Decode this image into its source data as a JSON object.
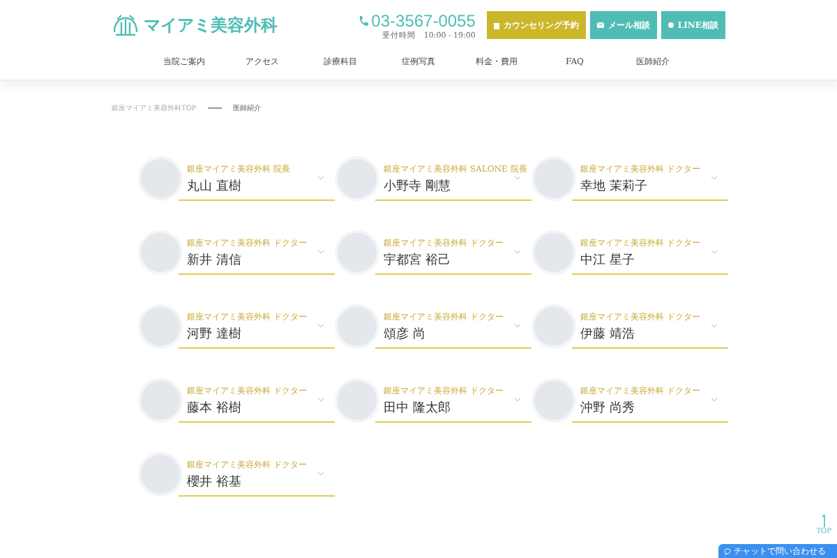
{
  "header": {
    "logo_text": "マイアミ美容外科",
    "phone": "03-3567-0055",
    "hours": "受付時間　10:00 - 19:00",
    "buttons": [
      {
        "kind": "counseling",
        "label": "カウンセリング予約"
      },
      {
        "kind": "mail",
        "label": "メール相談"
      },
      {
        "kind": "line",
        "label": "LINE相談"
      }
    ]
  },
  "nav": [
    "当院ご案内",
    "アクセス",
    "診療科目",
    "症例写真",
    "料金・費用",
    "FAQ",
    "医師紹介"
  ],
  "breadcrumb": [
    "銀座マイアミ美容外科TOP",
    "医師紹介"
  ],
  "doctors": [
    {
      "title": "銀座マイアミ美容外科 院長",
      "name": "丸山 直樹"
    },
    {
      "title": "銀座マイアミ美容外科 SALONE 院長",
      "name": "小野寺 剛慧"
    },
    {
      "title": "銀座マイアミ美容外科 ドクター",
      "name": "幸地 茉莉子"
    },
    {
      "title": "銀座マイアミ美容外科 ドクター",
      "name": "新井 清信"
    },
    {
      "title": "銀座マイアミ美容外科 ドクター",
      "name": "宇都宮 裕己"
    },
    {
      "title": "銀座マイアミ美容外科 ドクター",
      "name": "中江 星子"
    },
    {
      "title": "銀座マイアミ美容外科 ドクター",
      "name": "河野 達樹"
    },
    {
      "title": "銀座マイアミ美容外科 ドクター",
      "name": "頌彦 尚"
    },
    {
      "title": "銀座マイアミ美容外科 ドクター",
      "name": "伊藤 靖浩"
    },
    {
      "title": "銀座マイアミ美容外科 ドクター",
      "name": "藤本 裕樹"
    },
    {
      "title": "銀座マイアミ美容外科 ドクター",
      "name": "田中 隆太郎"
    },
    {
      "title": "銀座マイアミ美容外科 ドクター",
      "name": "沖野 尚秀"
    },
    {
      "title": "銀座マイアミ美容外科 ドクター",
      "name": "櫻井 裕基"
    }
  ],
  "page_top": "TOP",
  "chat_button": "チャットで問い合わせる"
}
